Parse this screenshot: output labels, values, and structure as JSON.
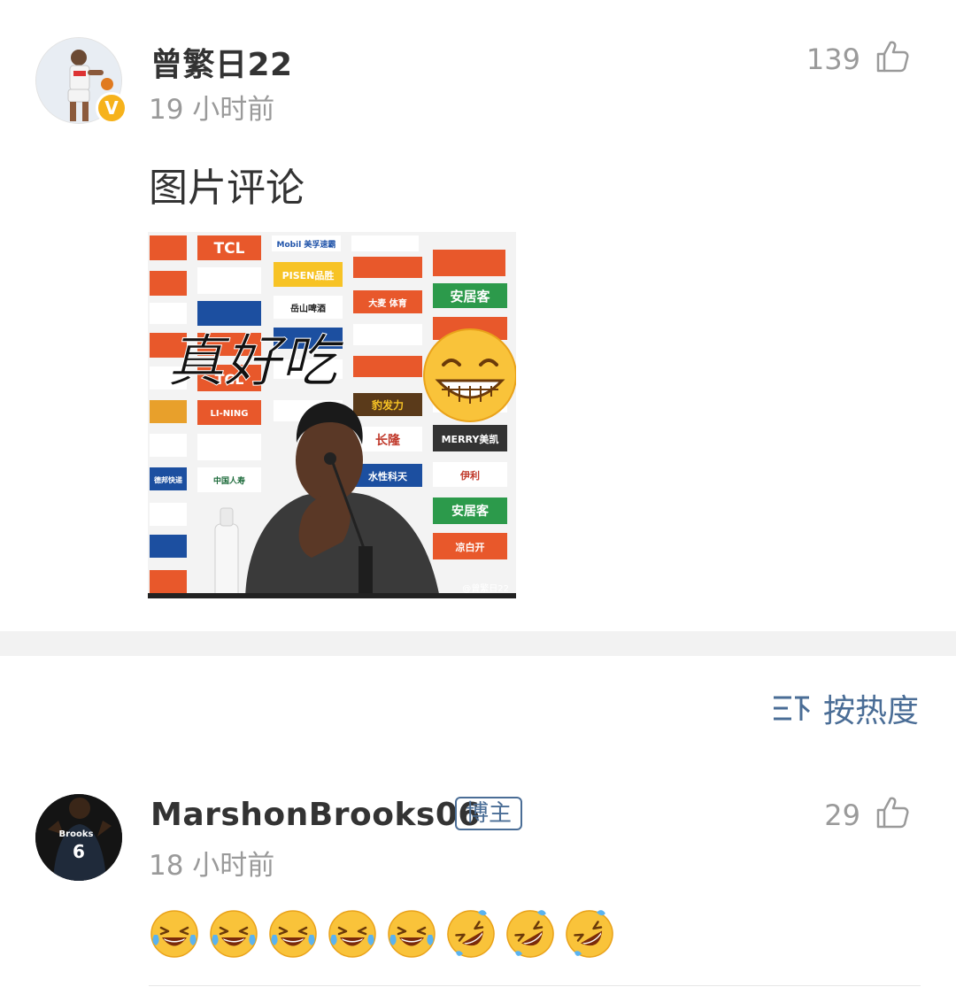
{
  "comments": [
    {
      "username": "曾繁日22",
      "time": "19 小时前",
      "likes": "139",
      "text": "图片评论",
      "verified_mark": "V",
      "image": {
        "caption": "真好吃",
        "sponsor_boards": [
          "TCL",
          "Mobil 美孚速霸",
          "PISEN品胜",
          "安居客",
          "岳山啤酒",
          "大麦 体育",
          "豹发力",
          "长隆",
          "MERRY美凯",
          "中国人寿",
          "水性科天",
          "伊利",
          "LI-NING",
          "德邦快递",
          "凉白开"
        ],
        "watermark": "@曾繁日22"
      }
    },
    {
      "username": "MarshonBrooks06",
      "badge": "博主",
      "time": "18 小时前",
      "likes": "29",
      "jersey_name": "Brooks",
      "jersey_number": "6",
      "emojis": [
        "laughing-tears",
        "laughing-tears",
        "laughing-tears",
        "laughing-tears",
        "laughing-tears",
        "rolling-laughing",
        "rolling-laughing",
        "rolling-laughing"
      ]
    }
  ],
  "sort": {
    "label": "按热度",
    "icon": "sort-icon"
  },
  "colors": {
    "link": "#4a6d96",
    "verified": "#f6b21b",
    "muted": "#9a9a9a"
  }
}
